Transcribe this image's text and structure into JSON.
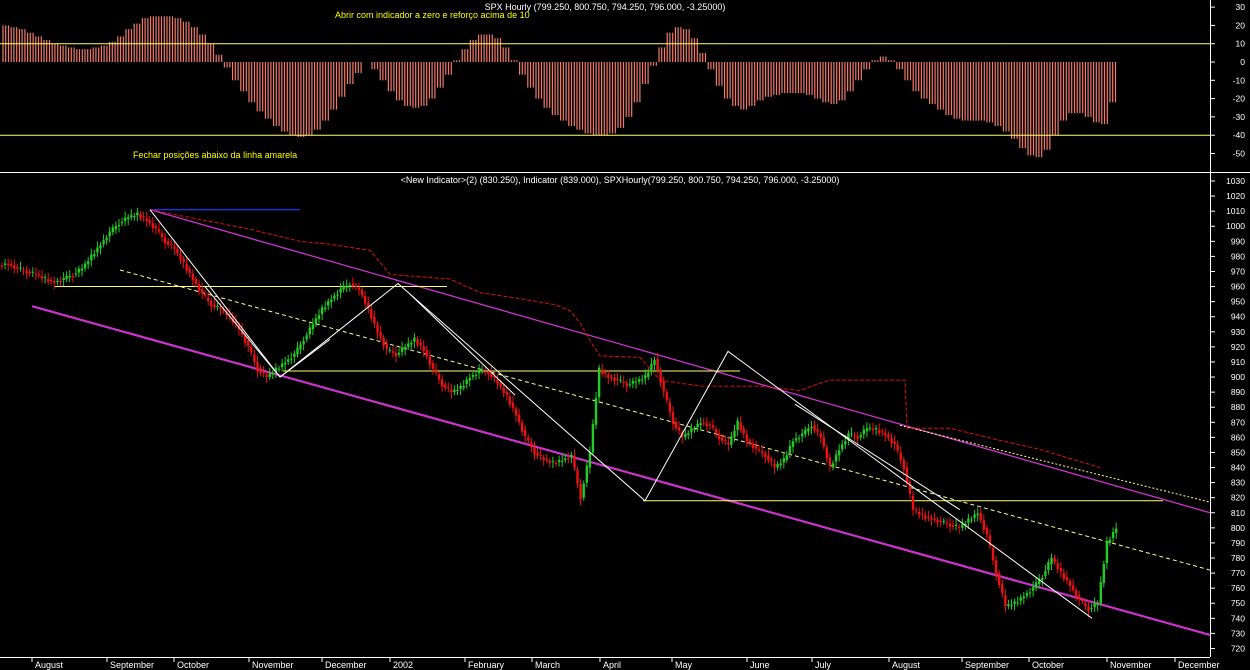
{
  "top_panel": {
    "header": "SPX Hourly (799.250, 800.750, 794.250, 796.000, -3.25000)",
    "note_open": "Abrir com indicador a zero e reforço acima de 10",
    "note_close": "Fechar posições abaixo da linha amarela",
    "levels": [
      10,
      -40
    ],
    "ylim": [
      -60,
      30
    ],
    "ticks": [
      30,
      20,
      10,
      0,
      -10,
      -20,
      -30,
      -40,
      -50
    ]
  },
  "main_panel": {
    "header": "<New Indicator>(2) (830.250), Indicator (839.000), SPXHourly(799.250, 800.750, 794.250, 796.000, -3.25000)",
    "ylim": [
      720,
      1030
    ],
    "ticks": [
      1030,
      1020,
      1010,
      1000,
      990,
      980,
      970,
      960,
      950,
      940,
      930,
      920,
      910,
      900,
      890,
      880,
      870,
      860,
      850,
      840,
      830,
      820,
      810,
      800,
      790,
      780,
      770,
      760,
      750,
      740,
      730,
      720
    ]
  },
  "x_axis": {
    "months": [
      "August",
      "September",
      "October",
      "November",
      "December",
      "2002",
      "February",
      "March",
      "April",
      "May",
      "June",
      "July",
      "August",
      "September",
      "October",
      "November",
      "December"
    ]
  },
  "colors": {
    "up": "#22cc22",
    "down": "#ee1111",
    "histogram": "#f07a68",
    "level_line": "#ffff66",
    "channel": "#cc33cc",
    "trend_dashed": "#ffff88",
    "stop_dashed": "#dd1111",
    "zigzag": "#ffffff",
    "resistance": "#2233cc",
    "note_text": "#ffff00"
  },
  "chart_data": [
    {
      "type": "bar",
      "title": "SPX Hourly (799.250, 800.750, 794.250, 796.000, -3.25000)",
      "series": [
        {
          "values": [
            20,
            19,
            18,
            16,
            14,
            12,
            10,
            9,
            8,
            7,
            7,
            8,
            9,
            11,
            14,
            18,
            21,
            24,
            25,
            25,
            25,
            24,
            22,
            19,
            15,
            10,
            4,
            -3,
            -10,
            -16,
            -22,
            -27,
            -31,
            -35,
            -38,
            -40,
            -41,
            -40,
            -37,
            -32,
            -26,
            -19,
            -12,
            -6,
            0,
            -4,
            -10,
            -16,
            -21,
            -24,
            -25,
            -24,
            -20,
            -14,
            -7,
            1,
            7,
            12,
            15,
            15,
            13,
            8,
            1,
            -7,
            -14,
            -20,
            -25,
            -29,
            -32,
            -35,
            -37,
            -39,
            -40,
            -40,
            -39,
            -36,
            -30,
            -22,
            -12,
            -2,
            8,
            16,
            19,
            18,
            13,
            5,
            -4,
            -13,
            -20,
            -24,
            -26,
            -24,
            -21,
            -19,
            -18,
            -17,
            -17,
            -17,
            -18,
            -20,
            -22,
            -23,
            -21,
            -16,
            -10,
            -4,
            1,
            3,
            1,
            -4,
            -10,
            -16,
            -20,
            -23,
            -26,
            -29,
            -31,
            -32,
            -32,
            -32,
            -33,
            -35,
            -38,
            -42,
            -47,
            -51,
            -52,
            -48,
            -40,
            -32,
            -28,
            -28,
            -30,
            -33,
            -34,
            -22
          ]
        }
      ],
      "levels": [
        10,
        -40
      ],
      "ylim": [
        -60,
        30
      ]
    },
    {
      "type": "line",
      "title": "<New Indicator>(2) (830.250), Indicator (839.000), SPXHourly(799.250, 800.750, 794.250, 796.000, -3.25000)",
      "ylim": [
        720,
        1030
      ],
      "series": [
        {
          "values": [
            975,
            972,
            970,
            968,
            965,
            963,
            965,
            968,
            972,
            980,
            988,
            996,
            1002,
            1006,
            1008,
            1004,
            998,
            990,
            985,
            975,
            965,
            955,
            948,
            945,
            940,
            932,
            920,
            905,
            900,
            905,
            910,
            915,
            925,
            935,
            945,
            952,
            958,
            962,
            958,
            945,
            930,
            918,
            915,
            920,
            925,
            918,
            905,
            895,
            890,
            893,
            900,
            904,
            903,
            896,
            887,
            875,
            860,
            850,
            845,
            843,
            845,
            848,
            820,
            850,
            905,
            900,
            898,
            895,
            897,
            900,
            912,
            890,
            870,
            860,
            865,
            870,
            868,
            860,
            855,
            870,
            858,
            852,
            848,
            840,
            845,
            858,
            862,
            868,
            860,
            840,
            852,
            862,
            860,
            866,
            865,
            862,
            855,
            840,
            812,
            808,
            806,
            804,
            802,
            800,
            805,
            810,
            795,
            770,
            748,
            750,
            755,
            760,
            768,
            780,
            770,
            762,
            752,
            746,
            750,
            790,
            800
          ]
        }
      ],
      "overlays": {
        "zigzag": [
          [
            1011,
            "Sep"
          ],
          [
            900,
            "Nov"
          ],
          [
            962,
            "Jan"
          ],
          [
            818,
            "Apr"
          ],
          [
            917,
            "May"
          ],
          [
            740,
            "Oct"
          ]
        ],
        "horizontal_levels": [
          1011,
          960,
          904,
          818
        ],
        "channel": "descending"
      }
    }
  ]
}
